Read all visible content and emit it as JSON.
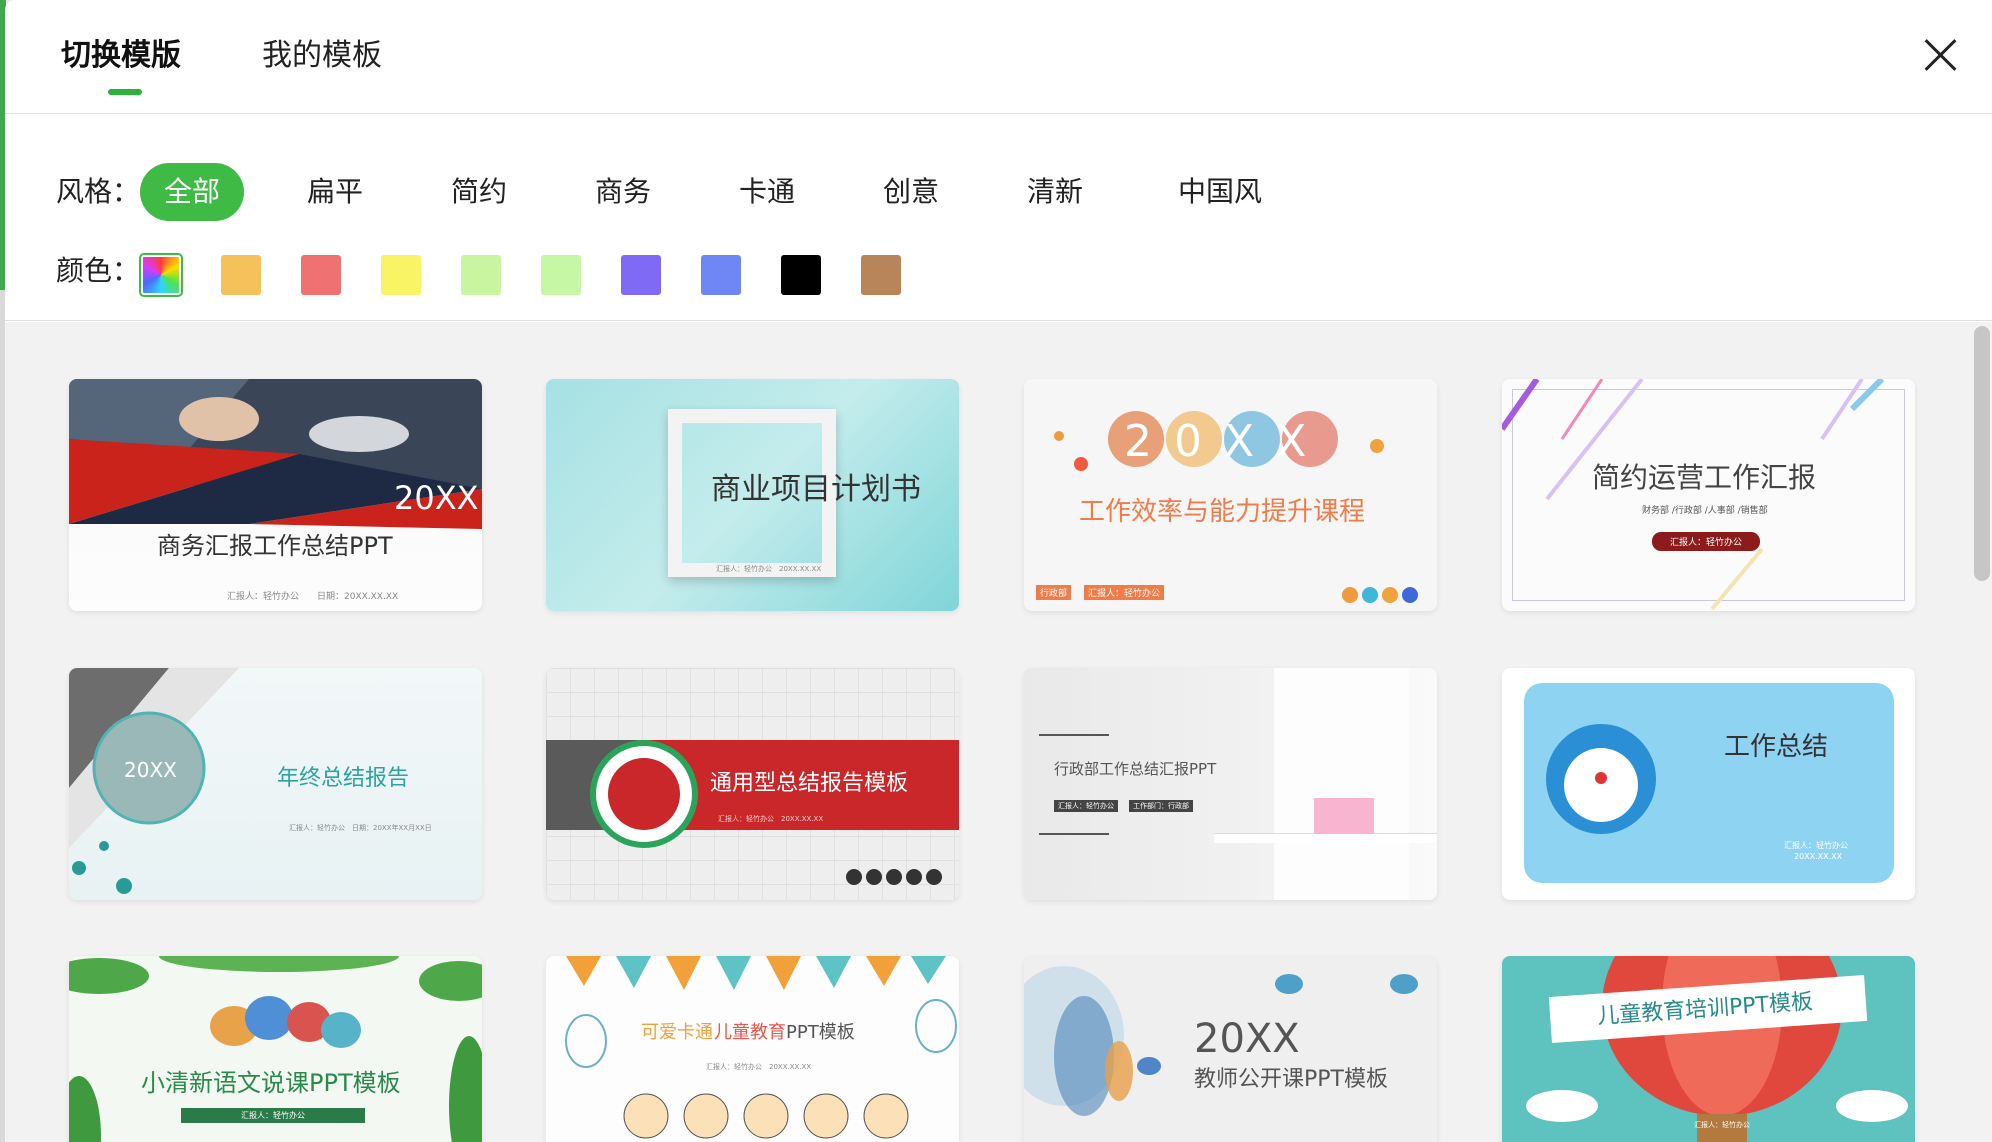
{
  "header": {
    "tabs": [
      {
        "label": "切换模版",
        "active": true
      },
      {
        "label": "我的模板",
        "active": false
      }
    ]
  },
  "filters": {
    "style_label": "风格：",
    "styles": [
      "全部",
      "扁平",
      "简约",
      "商务",
      "卡通",
      "创意",
      "清新",
      "中国风"
    ],
    "active_style": "全部",
    "color_label": "颜色：",
    "colors": [
      "rainbow",
      "#f5c15a",
      "#f07171",
      "#f8f466",
      "#c9f5a0",
      "#c6f7a5",
      "#7f6af5",
      "#6f86f5",
      "#000000",
      "#b8845a"
    ]
  },
  "templates": [
    {
      "title": "商务汇报工作总结PPT",
      "badge": "20XX",
      "sub": "汇报人：轻竹办公　　日期：20XX.XX.XX"
    },
    {
      "title": "商业项目计划书",
      "sub": "汇报人：轻竹办公　20XX.XX.XX"
    },
    {
      "title": "工作效率与能力提升课程",
      "badge": "20XX",
      "tags": [
        "行政部",
        "汇报人：轻竹办公"
      ]
    },
    {
      "title": "简约运营工作汇报",
      "sub": "财务部 /行政部 /人事部 /销售部",
      "pill": "汇报人：轻竹办公"
    },
    {
      "title": "年终总结报告",
      "badge": "20XX",
      "sub": "汇报人：轻竹办公　日期：20XX年XX月XX日"
    },
    {
      "title": "通用型总结报告模板",
      "sub": "汇报人：轻竹办公　20XX.XX.XX"
    },
    {
      "title": "行政部工作总结汇报PPT",
      "tags": [
        "汇报人：轻竹办公",
        "工作部门：行政部"
      ]
    },
    {
      "title": "工作总结",
      "sub": "汇报人：轻竹办公",
      "sub2": "20XX.XX.XX"
    },
    {
      "title": "小清新语文说课PPT模板",
      "pill": "汇报人：轻竹办公"
    },
    {
      "title_a": "可爱卡通",
      "title_b": "儿童教育",
      "title_c": "PPT模板",
      "sub": "汇报人：轻竹办公　20XX.XX.XX"
    },
    {
      "badge": "20XX",
      "title": "教师公开课PPT模板"
    },
    {
      "title": "儿童教育培训PPT模板",
      "sub": "汇报人：轻竹办公"
    }
  ]
}
